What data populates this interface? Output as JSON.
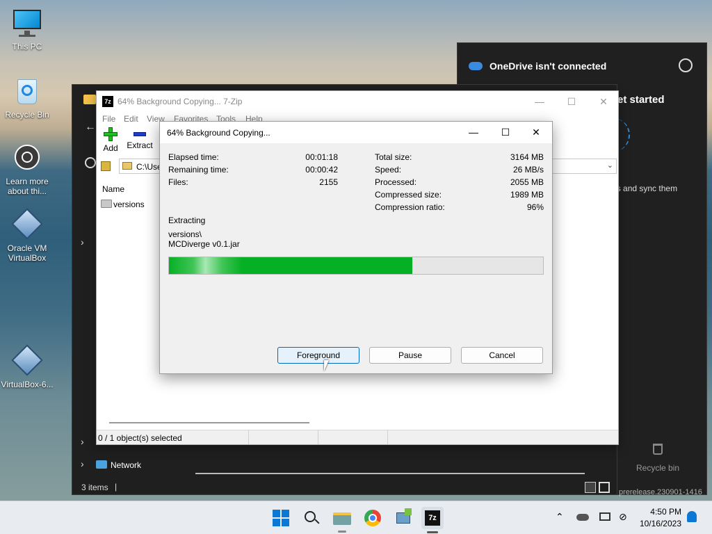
{
  "desktop": {
    "icons": [
      {
        "label": "This PC"
      },
      {
        "label": "Recycle Bin"
      },
      {
        "label": "Learn more about thi..."
      },
      {
        "label": "Oracle VM VirtualBox"
      },
      {
        "label": "VirtualBox-6..."
      }
    ],
    "watermark": "prerelease.230901-1416"
  },
  "explorer": {
    "nav_network": "Network",
    "status_items": "3 items",
    "status_sep": "|"
  },
  "onedrive": {
    "title": "OneDrive isn't connected",
    "get_started": "et started",
    "sync_text": "Attributes and sync them",
    "recycle_label": "Recycle bin"
  },
  "zip": {
    "title": "64% Background Copying... 7-Zip",
    "menu": [
      "File",
      "Edit",
      "View",
      "Favorites",
      "Tools",
      "Help"
    ],
    "toolbar": {
      "add": "Add",
      "extract": "Extract"
    },
    "address": "C:\\Use",
    "col_name": "Name",
    "row_versions": "versions",
    "status": "0 / 1 object(s) selected"
  },
  "dialog": {
    "title": "64% Background Copying...",
    "left_labels": [
      "Elapsed time:",
      "Remaining time:",
      "Files:"
    ],
    "left_values": [
      "00:01:18",
      "00:00:42",
      "2155"
    ],
    "right_labels": [
      "Total size:",
      "Speed:",
      "Processed:",
      "Compressed size:",
      "Compression ratio:"
    ],
    "right_values": [
      "3164 MB",
      "26 MB/s",
      "2055 MB",
      "1989 MB",
      "96%"
    ],
    "operation": "Extracting",
    "path_line1": "versions\\",
    "path_line2": "MCDiverge v0.1.jar",
    "progress_fraction": 0.65,
    "buttons": {
      "foreground": "Foreground",
      "pause": "Pause",
      "cancel": "Cancel"
    }
  },
  "taskbar": {
    "time": "4:50 PM",
    "date": "10/16/2023"
  },
  "colors": {
    "progress_green": "#06b025",
    "accent_blue": "#0067c0"
  }
}
